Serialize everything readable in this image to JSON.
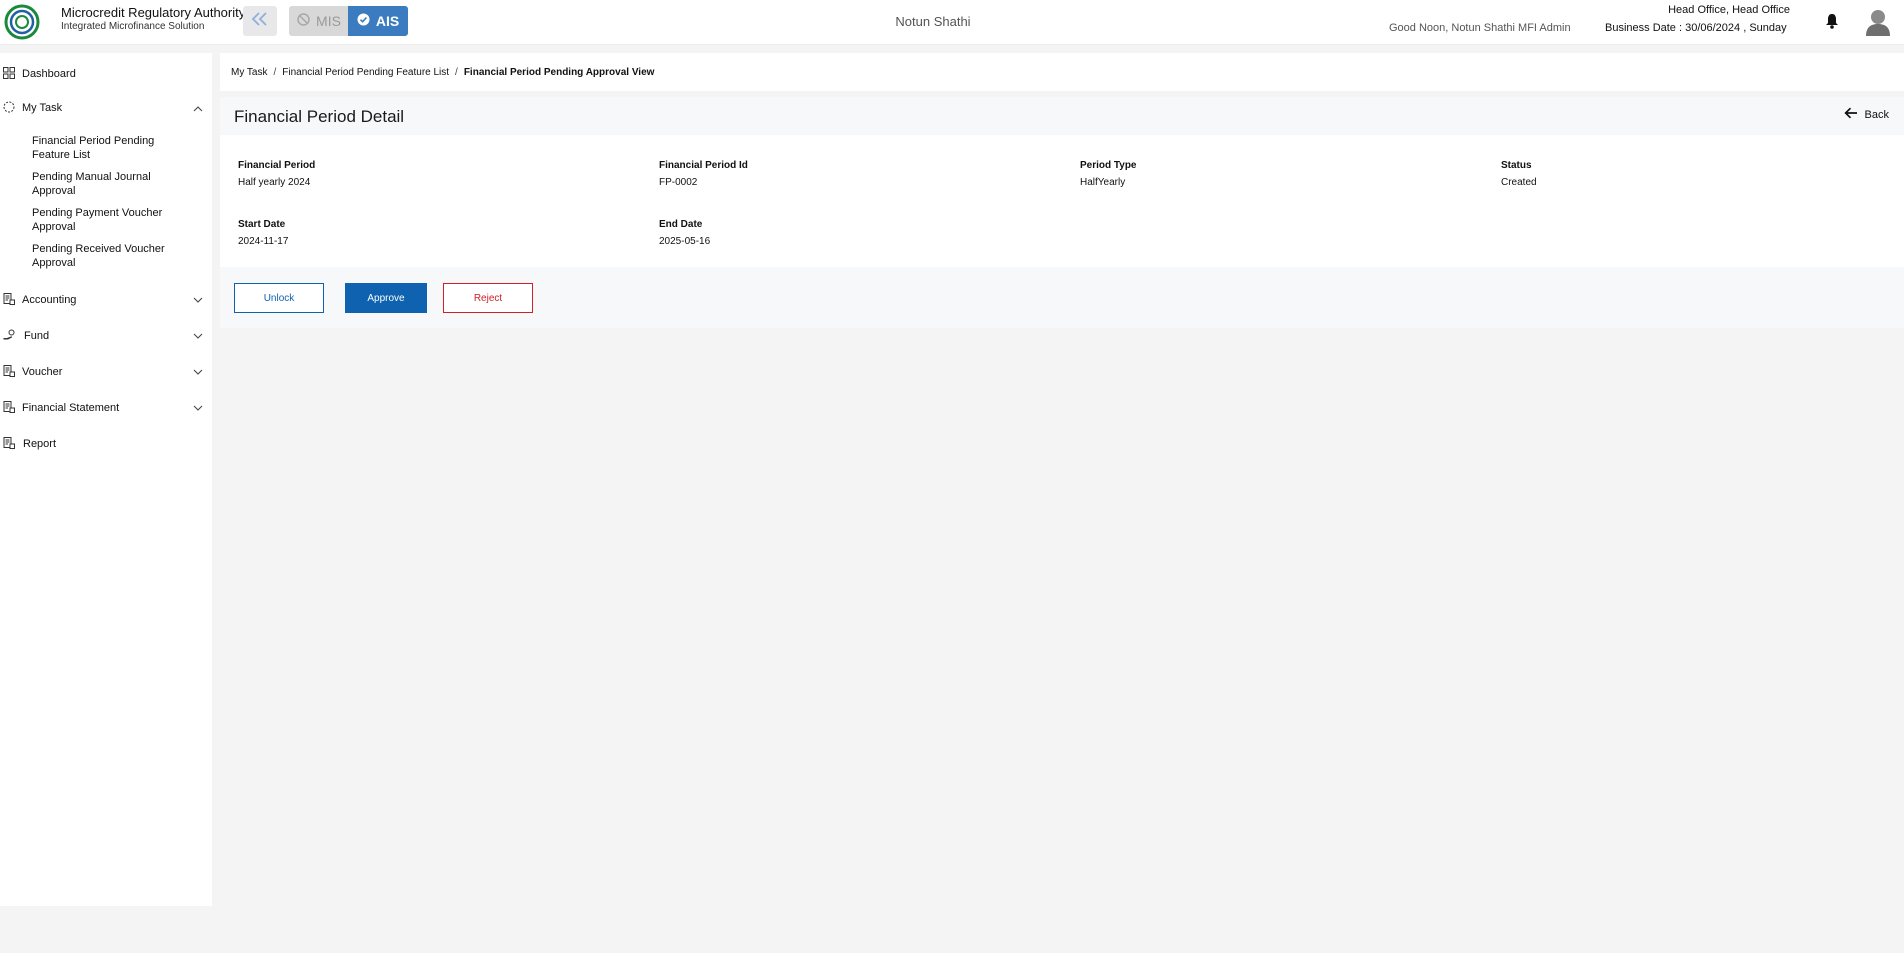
{
  "header": {
    "org_name": "Microcredit Regulatory Authority",
    "org_sub": "Integrated Microfinance Solution",
    "logo_text": "Microcredit Regulatory Authority",
    "mode_mis": "MIS",
    "mode_ais": "AIS",
    "center_title": "Notun Shathi",
    "greeting": "Good Noon, Notun Shathi MFI Admin",
    "office": "Head Office, Head Office",
    "business_date": "Business Date : 30/06/2024 , Sunday"
  },
  "sidebar": {
    "items": [
      {
        "label": "Dashboard",
        "icon": "grid-icon"
      },
      {
        "label": "My Task",
        "icon": "task-icon",
        "expanded": true
      },
      {
        "label": "Accounting",
        "icon": "ledger-icon"
      },
      {
        "label": "Fund",
        "icon": "hand-coin-icon"
      },
      {
        "label": "Voucher",
        "icon": "ledger-icon"
      },
      {
        "label": "Financial Statement",
        "icon": "ledger-icon"
      },
      {
        "label": "Report",
        "icon": "ledger-icon"
      }
    ],
    "mytask_sub": [
      "Financial Period Pending Feature List",
      "Pending Manual Journal Approval",
      "Pending Payment Voucher Approval",
      "Pending Received Voucher Approval"
    ]
  },
  "breadcrumb": [
    "My Task",
    "Financial Period Pending Feature List",
    "Financial Period Pending Approval View"
  ],
  "detail": {
    "title": "Financial Period Detail",
    "back_label": "Back",
    "fields": [
      {
        "label": "Financial Period",
        "value": "Half yearly 2024"
      },
      {
        "label": "Financial Period Id",
        "value": "FP-0002"
      },
      {
        "label": "Period Type",
        "value": "HalfYearly"
      },
      {
        "label": "Status",
        "value": "Created"
      },
      {
        "label": "Start Date",
        "value": "2024-11-17"
      },
      {
        "label": "End Date",
        "value": "2025-05-16"
      }
    ]
  },
  "actions": {
    "unlock": "Unlock",
    "approve": "Approve",
    "reject": "Reject"
  },
  "colors": {
    "primary": "#0f62b0",
    "danger": "#d0202a",
    "ais_active": "#3b7cc0"
  }
}
